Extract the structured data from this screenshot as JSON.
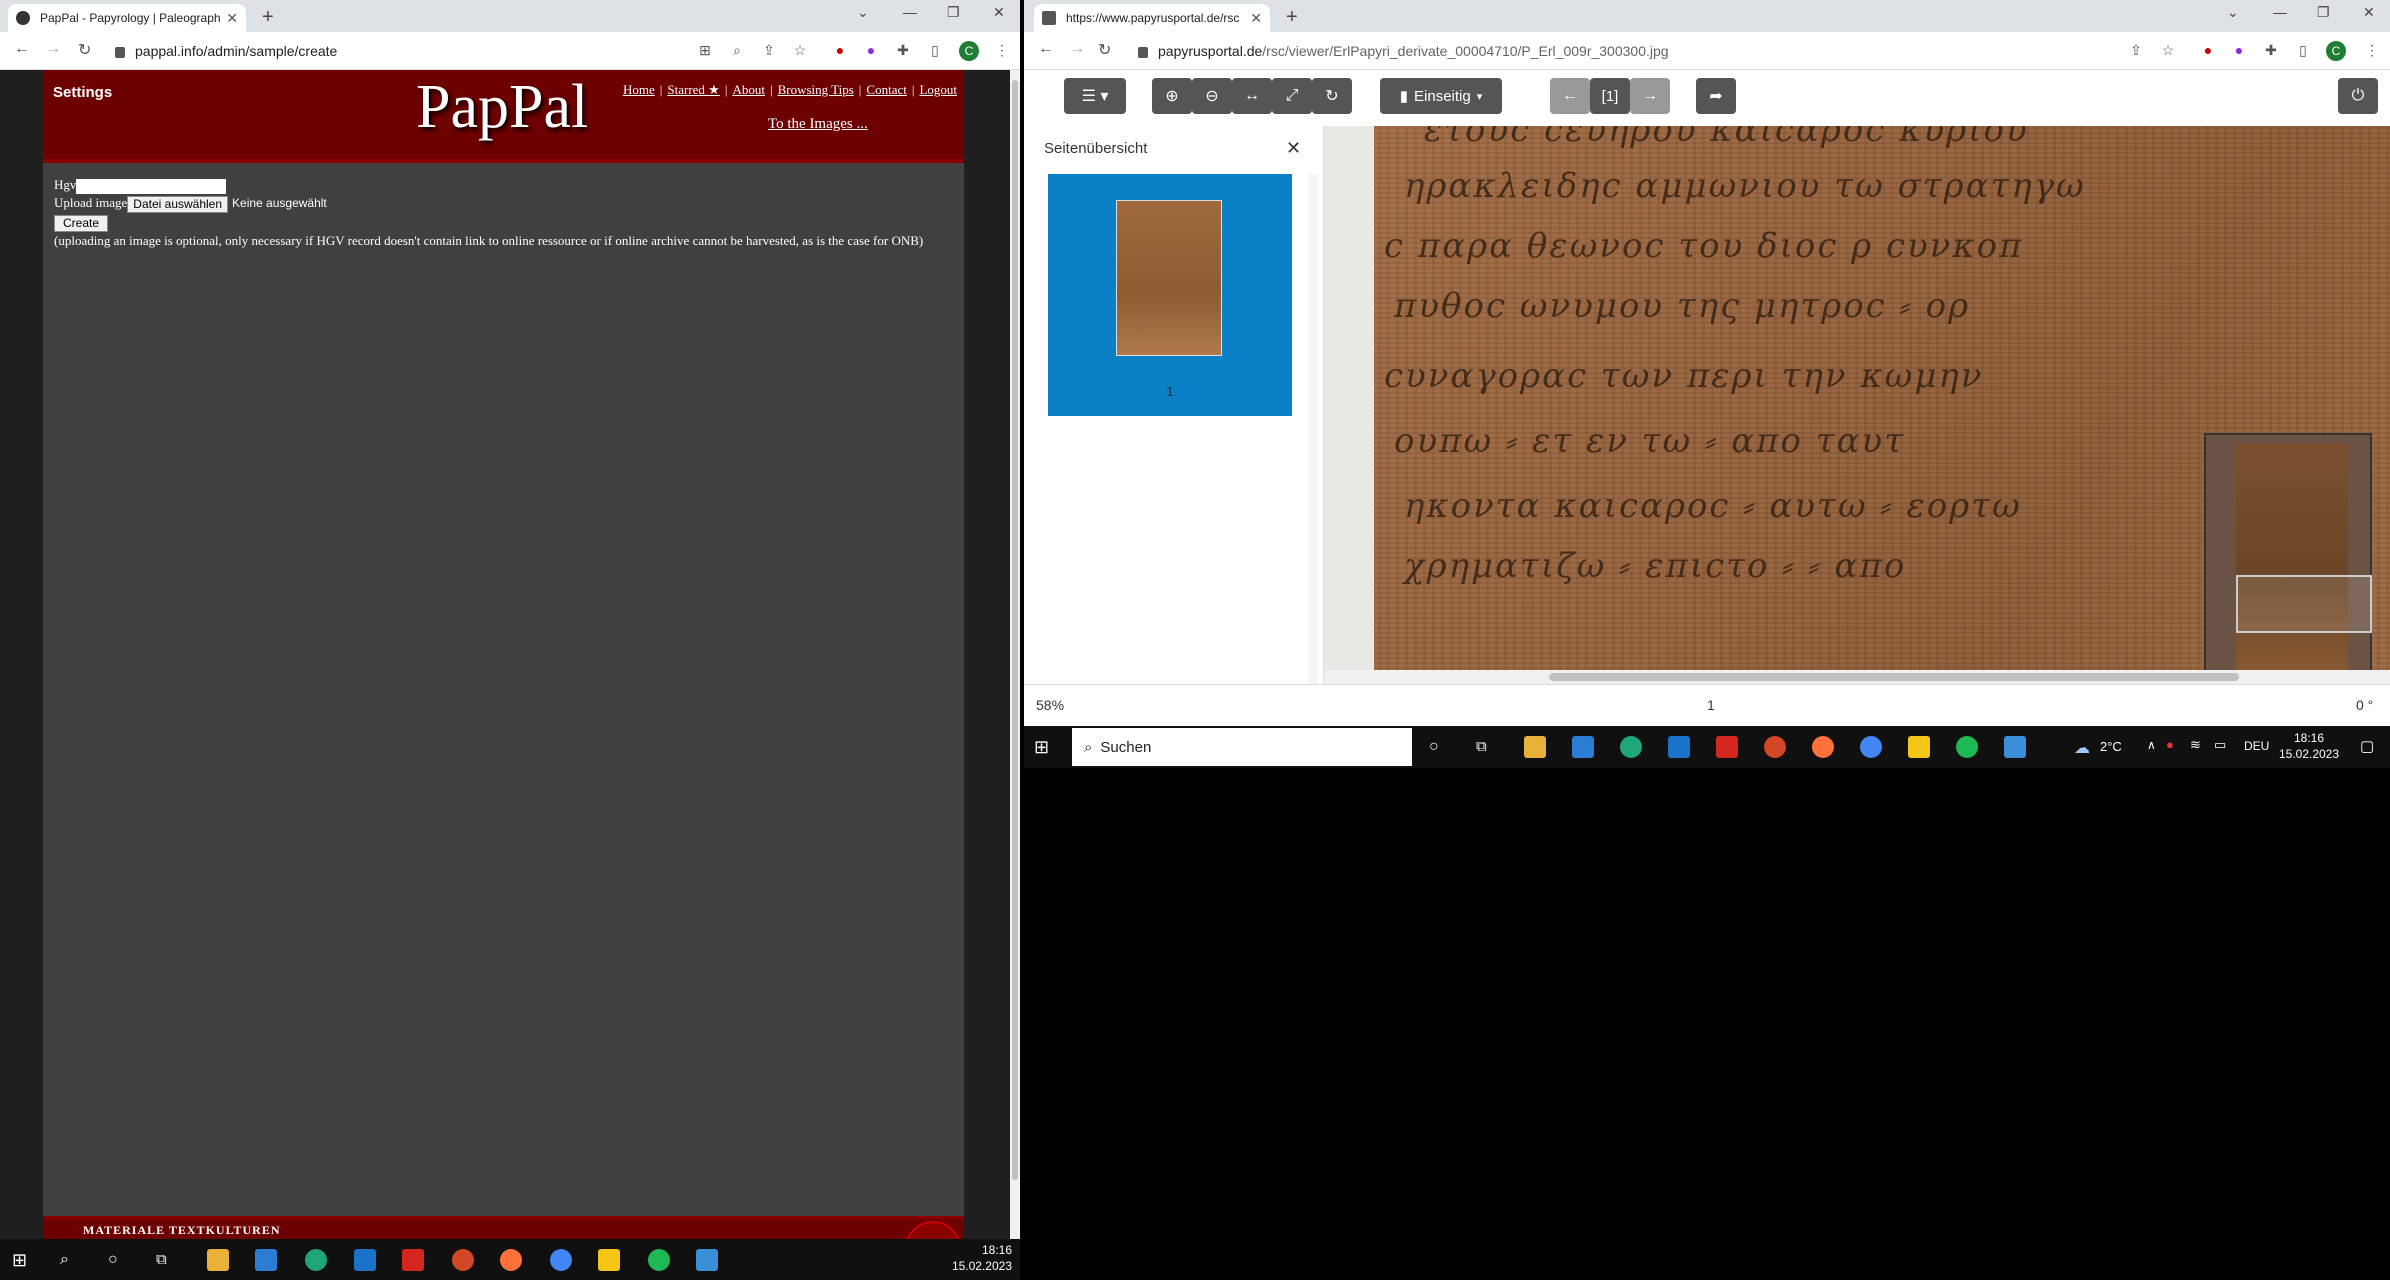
{
  "left_window": {
    "tab_title": "PapPal - Papyrology | Paleograph",
    "url": "pappal.info/admin/sample/create",
    "avatar_letter": "C",
    "site": {
      "settings_label": "Settings",
      "logo": "PapPal",
      "nav": [
        "Home",
        "Starred ★",
        "About",
        "Browsing Tips",
        "Contact",
        "Logout"
      ],
      "to_images": "To the Images ...",
      "hgv_label": "Hgv",
      "upload_label": "Upload image",
      "file_button": "Datei auswählen",
      "no_file": "Keine ausgewählt",
      "create_button": "Create",
      "note": "(uploading an image is optional, only necessary if HGV record doesn't contain link to online ressource or if online archive cannot be harvested, as is the case for ONB)",
      "footer_text": "Materiale Textkulturen"
    }
  },
  "right_window": {
    "tab_title": "https://www.papyrusportal.de/rsc",
    "url_host": "papyrusportal.de",
    "url_path": "/rsc/viewer/ErlPapyri_derivate_00004710/P_Erl_009r_300300.jpg",
    "avatar_letter": "C",
    "toolbar": {
      "view_mode": "Einseitig",
      "page_indicator": "[1]"
    },
    "sidebar": {
      "title": "Seitenübersicht",
      "thumb_label": "1"
    },
    "status": {
      "zoom": "58%",
      "page": "1",
      "rotation": "0 °"
    }
  },
  "taskbar_right": {
    "search_placeholder": "Suchen",
    "weather": "2°C",
    "lang": "DEU",
    "time": "18:16",
    "date": "15.02.2023"
  },
  "taskbar_left": {
    "time": "18:16",
    "date": "15.02.2023"
  }
}
